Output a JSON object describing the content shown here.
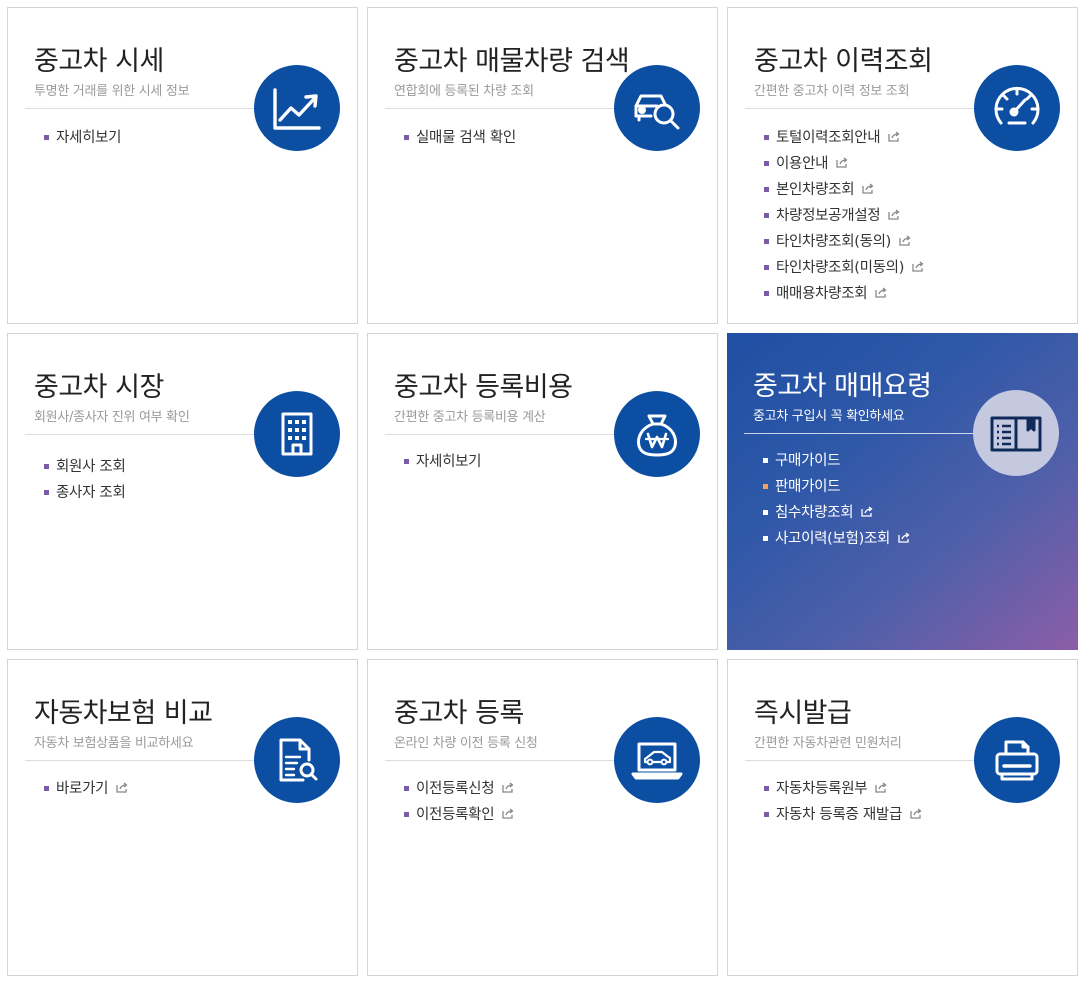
{
  "cards": [
    {
      "title": "중고차 시세",
      "subtitle": "투명한 거래를 위한 시세 정보",
      "icon": "chart-trend-icon",
      "links": [
        {
          "label": "자세히보기",
          "external": false
        }
      ]
    },
    {
      "title": "중고차 매물차량 검색",
      "subtitle": "연합회에 등록된 차량 조회",
      "icon": "car-search-icon",
      "links": [
        {
          "label": "실매물 검색 확인",
          "external": false
        }
      ]
    },
    {
      "title": "중고차 이력조회",
      "subtitle": "간편한 중고차 이력 정보 조회",
      "icon": "speedometer-icon",
      "links": [
        {
          "label": "토털이력조회안내",
          "external": true
        },
        {
          "label": "이용안내",
          "external": true
        },
        {
          "label": "본인차량조회",
          "external": true
        },
        {
          "label": "차량정보공개설정",
          "external": true
        },
        {
          "label": "타인차량조회(동의)",
          "external": true
        },
        {
          "label": "타인차량조회(미동의)",
          "external": true
        },
        {
          "label": "매매용차량조회",
          "external": true
        }
      ]
    },
    {
      "title": "중고차 시장",
      "subtitle": "회원사/종사자 진위 여부 확인",
      "icon": "building-icon",
      "links": [
        {
          "label": "회원사 조회",
          "external": false
        },
        {
          "label": "종사자 조회",
          "external": false
        }
      ]
    },
    {
      "title": "중고차 등록비용",
      "subtitle": "간편한 중고차 등록비용 계산",
      "icon": "money-bag-icon",
      "links": [
        {
          "label": "자세히보기",
          "external": false
        }
      ]
    },
    {
      "title": "중고차 매매요령",
      "subtitle": "중고차 구입시 꼭 확인하세요",
      "icon": "book-icon",
      "featured": true,
      "links": [
        {
          "label": "구매가이드",
          "external": false
        },
        {
          "label": "판매가이드",
          "external": false,
          "active": true
        },
        {
          "label": "침수차량조회",
          "external": true
        },
        {
          "label": "사고이력(보험)조회",
          "external": true
        }
      ]
    },
    {
      "title": "자동차보험 비교",
      "subtitle": "자동차 보험상품을 비교하세요",
      "icon": "document-search-icon",
      "links": [
        {
          "label": "바로가기",
          "external": true
        }
      ]
    },
    {
      "title": "중고차 등록",
      "subtitle": "온라인 차량 이전 등록 신청",
      "icon": "laptop-car-icon",
      "links": [
        {
          "label": "이전등록신청",
          "external": true
        },
        {
          "label": "이전등록확인",
          "external": true
        }
      ]
    },
    {
      "title": "즉시발급",
      "subtitle": "간편한 자동차관련 민원처리",
      "icon": "printer-icon",
      "links": [
        {
          "label": "자동차등록원부",
          "external": true
        },
        {
          "label": "자동차 등록증 재발급",
          "external": true
        }
      ]
    }
  ],
  "colors": {
    "icon_circle": "#0b4ea2",
    "bullet": "#7b5aa6",
    "active_bullet": "#f0a15e",
    "featured_gradient_start": "#1f4fa3",
    "featured_gradient_end": "#8c5ea8"
  }
}
